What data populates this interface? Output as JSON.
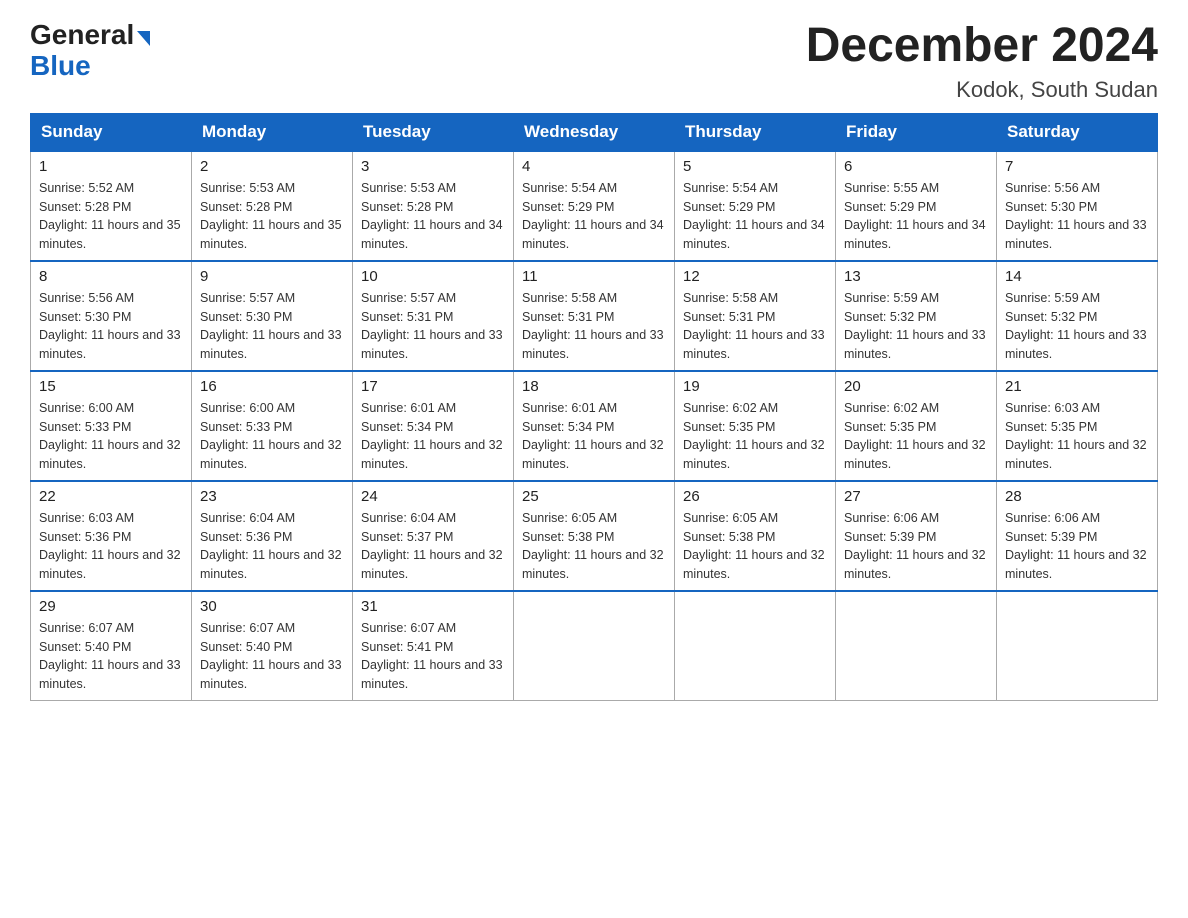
{
  "logo": {
    "general": "General",
    "blue": "Blue",
    "triangle": true
  },
  "title": {
    "month_year": "December 2024",
    "location": "Kodok, South Sudan"
  },
  "days_of_week": [
    "Sunday",
    "Monday",
    "Tuesday",
    "Wednesday",
    "Thursday",
    "Friday",
    "Saturday"
  ],
  "weeks": [
    [
      {
        "day": "1",
        "sunrise": "5:52 AM",
        "sunset": "5:28 PM",
        "daylight": "11 hours and 35 minutes."
      },
      {
        "day": "2",
        "sunrise": "5:53 AM",
        "sunset": "5:28 PM",
        "daylight": "11 hours and 35 minutes."
      },
      {
        "day": "3",
        "sunrise": "5:53 AM",
        "sunset": "5:28 PM",
        "daylight": "11 hours and 34 minutes."
      },
      {
        "day": "4",
        "sunrise": "5:54 AM",
        "sunset": "5:29 PM",
        "daylight": "11 hours and 34 minutes."
      },
      {
        "day": "5",
        "sunrise": "5:54 AM",
        "sunset": "5:29 PM",
        "daylight": "11 hours and 34 minutes."
      },
      {
        "day": "6",
        "sunrise": "5:55 AM",
        "sunset": "5:29 PM",
        "daylight": "11 hours and 34 minutes."
      },
      {
        "day": "7",
        "sunrise": "5:56 AM",
        "sunset": "5:30 PM",
        "daylight": "11 hours and 33 minutes."
      }
    ],
    [
      {
        "day": "8",
        "sunrise": "5:56 AM",
        "sunset": "5:30 PM",
        "daylight": "11 hours and 33 minutes."
      },
      {
        "day": "9",
        "sunrise": "5:57 AM",
        "sunset": "5:30 PM",
        "daylight": "11 hours and 33 minutes."
      },
      {
        "day": "10",
        "sunrise": "5:57 AM",
        "sunset": "5:31 PM",
        "daylight": "11 hours and 33 minutes."
      },
      {
        "day": "11",
        "sunrise": "5:58 AM",
        "sunset": "5:31 PM",
        "daylight": "11 hours and 33 minutes."
      },
      {
        "day": "12",
        "sunrise": "5:58 AM",
        "sunset": "5:31 PM",
        "daylight": "11 hours and 33 minutes."
      },
      {
        "day": "13",
        "sunrise": "5:59 AM",
        "sunset": "5:32 PM",
        "daylight": "11 hours and 33 minutes."
      },
      {
        "day": "14",
        "sunrise": "5:59 AM",
        "sunset": "5:32 PM",
        "daylight": "11 hours and 33 minutes."
      }
    ],
    [
      {
        "day": "15",
        "sunrise": "6:00 AM",
        "sunset": "5:33 PM",
        "daylight": "11 hours and 32 minutes."
      },
      {
        "day": "16",
        "sunrise": "6:00 AM",
        "sunset": "5:33 PM",
        "daylight": "11 hours and 32 minutes."
      },
      {
        "day": "17",
        "sunrise": "6:01 AM",
        "sunset": "5:34 PM",
        "daylight": "11 hours and 32 minutes."
      },
      {
        "day": "18",
        "sunrise": "6:01 AM",
        "sunset": "5:34 PM",
        "daylight": "11 hours and 32 minutes."
      },
      {
        "day": "19",
        "sunrise": "6:02 AM",
        "sunset": "5:35 PM",
        "daylight": "11 hours and 32 minutes."
      },
      {
        "day": "20",
        "sunrise": "6:02 AM",
        "sunset": "5:35 PM",
        "daylight": "11 hours and 32 minutes."
      },
      {
        "day": "21",
        "sunrise": "6:03 AM",
        "sunset": "5:35 PM",
        "daylight": "11 hours and 32 minutes."
      }
    ],
    [
      {
        "day": "22",
        "sunrise": "6:03 AM",
        "sunset": "5:36 PM",
        "daylight": "11 hours and 32 minutes."
      },
      {
        "day": "23",
        "sunrise": "6:04 AM",
        "sunset": "5:36 PM",
        "daylight": "11 hours and 32 minutes."
      },
      {
        "day": "24",
        "sunrise": "6:04 AM",
        "sunset": "5:37 PM",
        "daylight": "11 hours and 32 minutes."
      },
      {
        "day": "25",
        "sunrise": "6:05 AM",
        "sunset": "5:38 PM",
        "daylight": "11 hours and 32 minutes."
      },
      {
        "day": "26",
        "sunrise": "6:05 AM",
        "sunset": "5:38 PM",
        "daylight": "11 hours and 32 minutes."
      },
      {
        "day": "27",
        "sunrise": "6:06 AM",
        "sunset": "5:39 PM",
        "daylight": "11 hours and 32 minutes."
      },
      {
        "day": "28",
        "sunrise": "6:06 AM",
        "sunset": "5:39 PM",
        "daylight": "11 hours and 32 minutes."
      }
    ],
    [
      {
        "day": "29",
        "sunrise": "6:07 AM",
        "sunset": "5:40 PM",
        "daylight": "11 hours and 33 minutes."
      },
      {
        "day": "30",
        "sunrise": "6:07 AM",
        "sunset": "5:40 PM",
        "daylight": "11 hours and 33 minutes."
      },
      {
        "day": "31",
        "sunrise": "6:07 AM",
        "sunset": "5:41 PM",
        "daylight": "11 hours and 33 minutes."
      },
      null,
      null,
      null,
      null
    ]
  ]
}
